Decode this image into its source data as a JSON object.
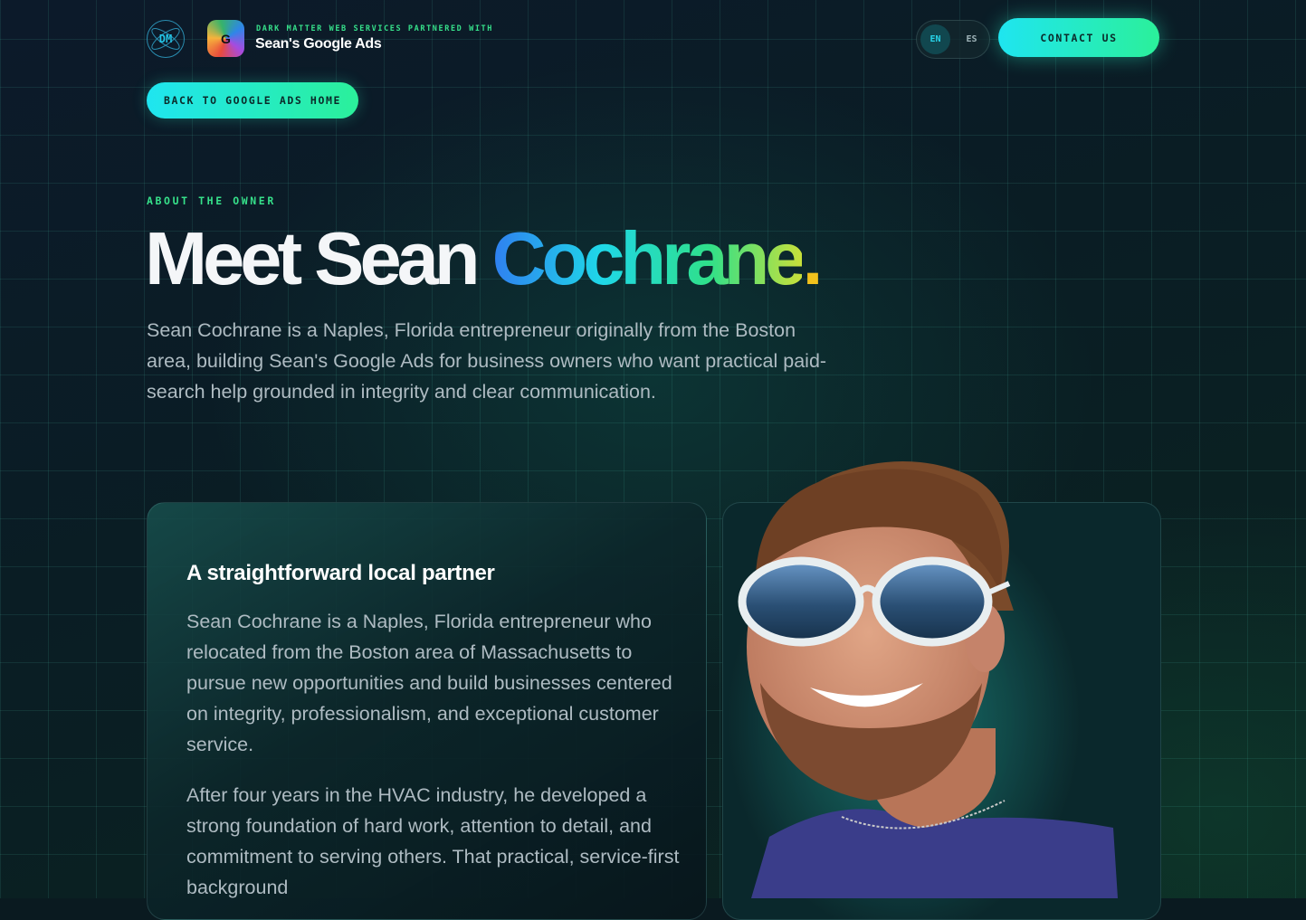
{
  "header": {
    "logo_text": "DM",
    "google_logo_letter": "G",
    "partner_line": "DARK MATTER WEB SERVICES PARTNERED WITH",
    "brand_name": "Sean's Google Ads",
    "languages": [
      "EN",
      "ES"
    ],
    "active_language": "EN",
    "contact_label": "CONTACT US"
  },
  "nav": {
    "back_label": "BACK TO GOOGLE ADS HOME"
  },
  "hero": {
    "eyebrow": "ABOUT THE OWNER",
    "title_plain": "Meet Sean ",
    "title_highlight": "Cochrane",
    "title_period": ".",
    "intro": "Sean Cochrane is a Naples, Florida entrepreneur originally from the Boston area, building Sean's Google Ads for business owners who want practical paid-search help grounded in integrity and clear communication."
  },
  "about_card": {
    "title": "A straightforward local partner",
    "paragraph_1": "Sean Cochrane is a Naples, Florida entrepreneur who relocated from the Boston area of Massachusetts to pursue new opportunities and build businesses centered on integrity, professionalism, and exceptional customer service.",
    "paragraph_2": "After four years in the HVAC industry, he developed a strong foundation of hard work, attention to detail, and commitment to serving others. That practical, service-first background"
  },
  "colors": {
    "accent_cyan": "#1fe5f0",
    "accent_green": "#2bf09a",
    "eyebrow_green": "#36e08a",
    "period_yellow": "#f2c21c"
  }
}
